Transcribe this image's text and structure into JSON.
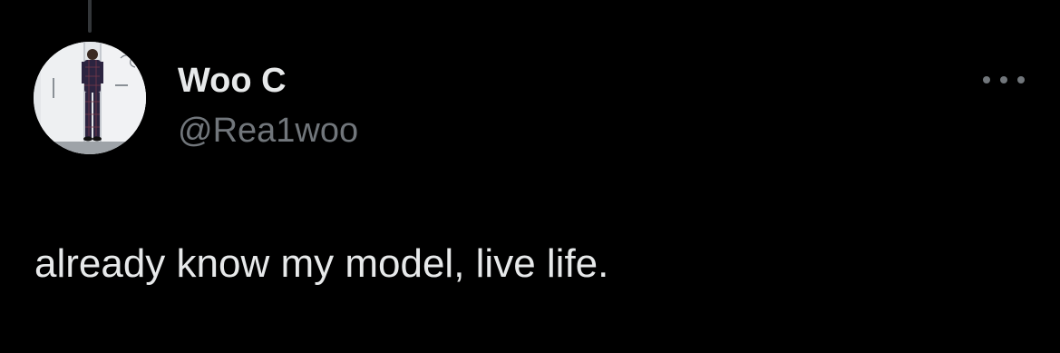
{
  "tweet": {
    "author": {
      "display_name": "Woo C",
      "handle": "@Rea1woo",
      "avatar_icon": "profile-photo"
    },
    "text": "already know my model, live life.",
    "more_menu_icon": "more-horizontal-icon"
  },
  "colors": {
    "background": "#000000",
    "primary_text": "#e7e9ea",
    "secondary_text": "#71767b",
    "thread_line": "#333639"
  }
}
